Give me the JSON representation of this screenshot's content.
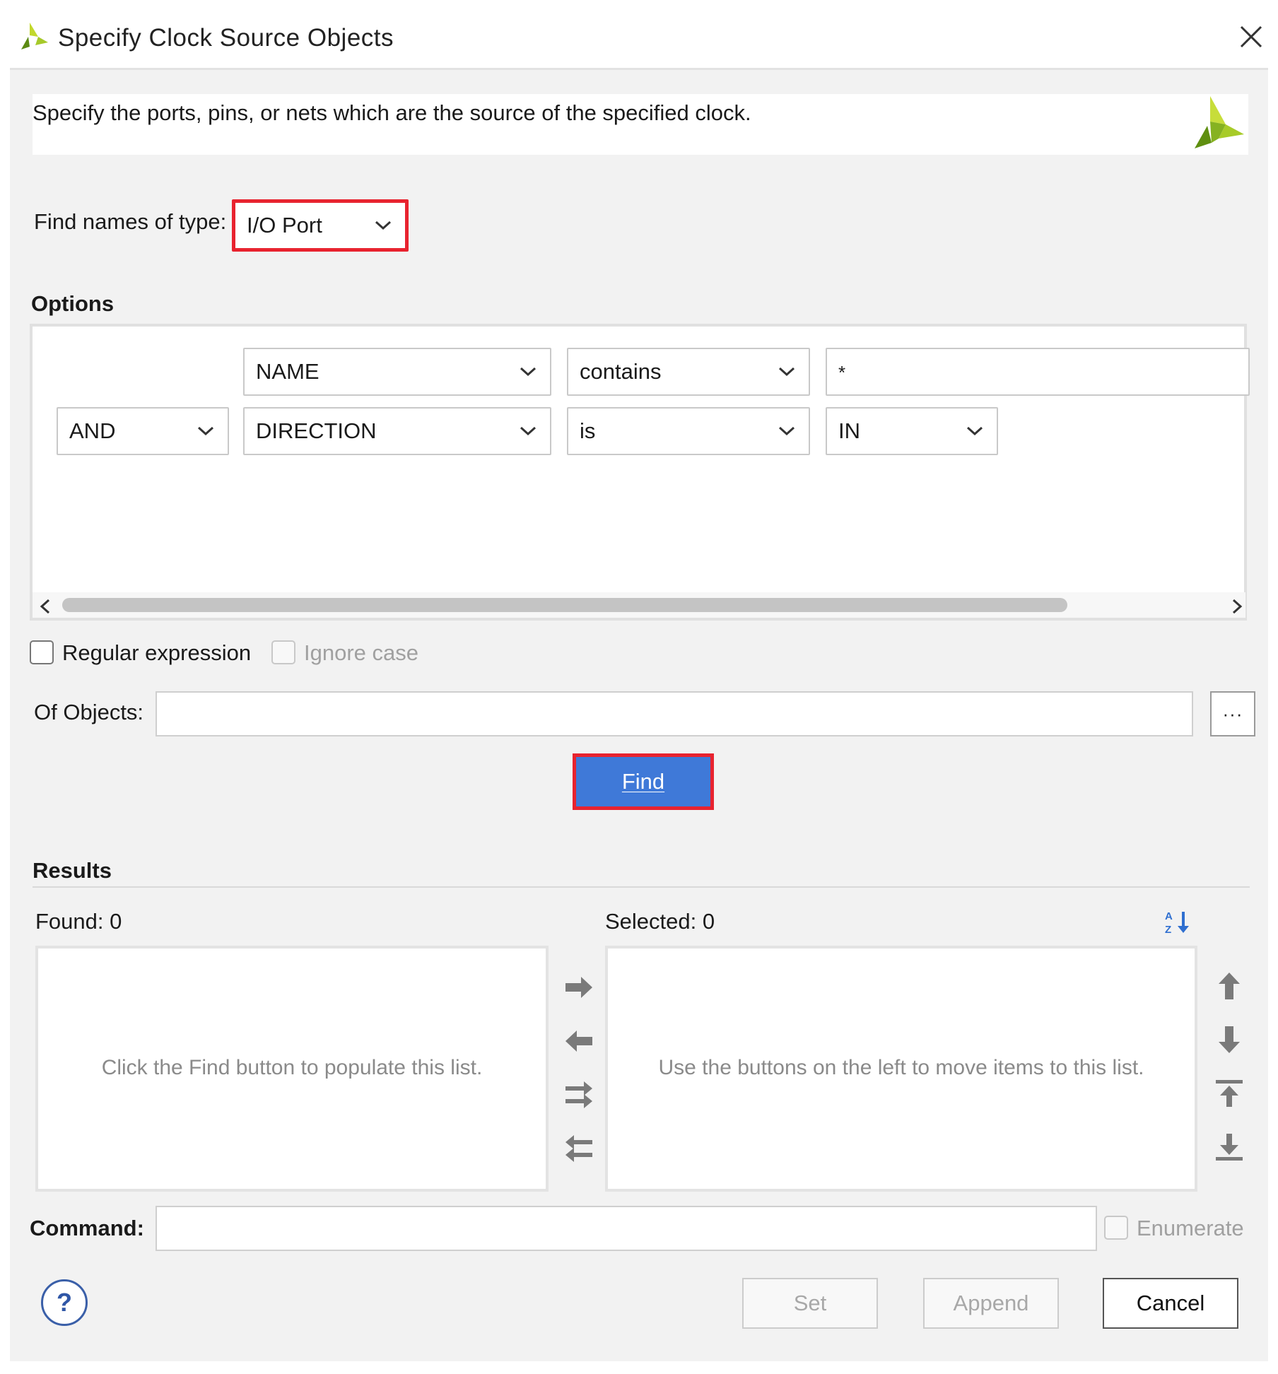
{
  "window": {
    "title": "Specify Clock Source Objects",
    "close_icon": "close-icon"
  },
  "banner": {
    "text": "Specify the ports, pins, or nets which are the source of the specified clock."
  },
  "find_type": {
    "label": "Find names of type:",
    "value": "I/O Port"
  },
  "options": {
    "heading": "Options",
    "rows": [
      {
        "field": "NAME",
        "operator": "contains",
        "value": "*"
      },
      {
        "logic": "AND",
        "field": "DIRECTION",
        "operator": "is",
        "value": "IN"
      }
    ]
  },
  "regular_expression": {
    "label": "Regular expression",
    "checked": false
  },
  "ignore_case": {
    "label": "Ignore case",
    "checked": false,
    "enabled": false
  },
  "of_objects": {
    "label": "Of Objects:",
    "value": "",
    "browse_label": "···"
  },
  "find_button": {
    "label": "Find"
  },
  "results": {
    "heading": "Results",
    "found_label": "Found: 0",
    "selected_label": "Selected: 0",
    "found_hint": "Click the Find button to populate this list.",
    "selected_hint": "Use the buttons on the left to move items to this list."
  },
  "command": {
    "label": "Command:",
    "value": ""
  },
  "enumerate": {
    "label": "Enumerate",
    "checked": false,
    "enabled": false
  },
  "buttons": {
    "set": "Set",
    "append": "Append",
    "cancel": "Cancel",
    "help": "?"
  },
  "colors": {
    "accent": "#3f79d8",
    "highlight": "#e8232f",
    "logo_green": "#7ab51d"
  }
}
